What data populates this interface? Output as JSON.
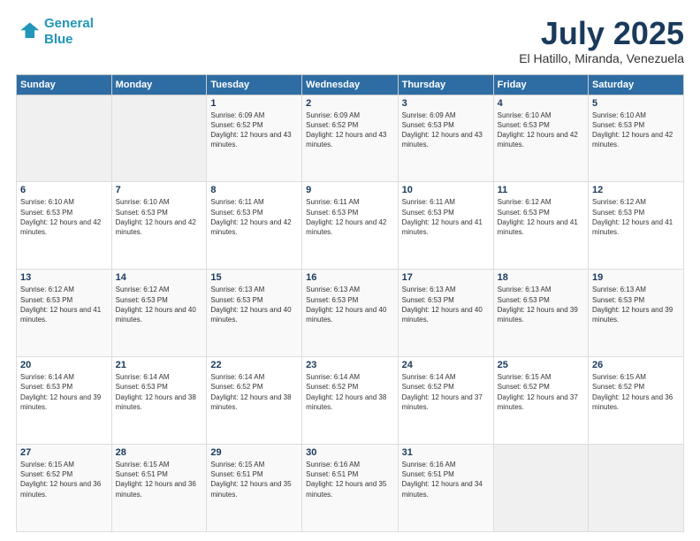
{
  "logo": {
    "line1": "General",
    "line2": "Blue"
  },
  "title": "July 2025",
  "subtitle": "El Hatillo, Miranda, Venezuela",
  "days_header": [
    "Sunday",
    "Monday",
    "Tuesday",
    "Wednesday",
    "Thursday",
    "Friday",
    "Saturday"
  ],
  "weeks": [
    [
      {
        "day": "",
        "info": ""
      },
      {
        "day": "",
        "info": ""
      },
      {
        "day": "1",
        "info": "Sunrise: 6:09 AM\nSunset: 6:52 PM\nDaylight: 12 hours and 43 minutes."
      },
      {
        "day": "2",
        "info": "Sunrise: 6:09 AM\nSunset: 6:52 PM\nDaylight: 12 hours and 43 minutes."
      },
      {
        "day": "3",
        "info": "Sunrise: 6:09 AM\nSunset: 6:53 PM\nDaylight: 12 hours and 43 minutes."
      },
      {
        "day": "4",
        "info": "Sunrise: 6:10 AM\nSunset: 6:53 PM\nDaylight: 12 hours and 42 minutes."
      },
      {
        "day": "5",
        "info": "Sunrise: 6:10 AM\nSunset: 6:53 PM\nDaylight: 12 hours and 42 minutes."
      }
    ],
    [
      {
        "day": "6",
        "info": "Sunrise: 6:10 AM\nSunset: 6:53 PM\nDaylight: 12 hours and 42 minutes."
      },
      {
        "day": "7",
        "info": "Sunrise: 6:10 AM\nSunset: 6:53 PM\nDaylight: 12 hours and 42 minutes."
      },
      {
        "day": "8",
        "info": "Sunrise: 6:11 AM\nSunset: 6:53 PM\nDaylight: 12 hours and 42 minutes."
      },
      {
        "day": "9",
        "info": "Sunrise: 6:11 AM\nSunset: 6:53 PM\nDaylight: 12 hours and 42 minutes."
      },
      {
        "day": "10",
        "info": "Sunrise: 6:11 AM\nSunset: 6:53 PM\nDaylight: 12 hours and 41 minutes."
      },
      {
        "day": "11",
        "info": "Sunrise: 6:12 AM\nSunset: 6:53 PM\nDaylight: 12 hours and 41 minutes."
      },
      {
        "day": "12",
        "info": "Sunrise: 6:12 AM\nSunset: 6:53 PM\nDaylight: 12 hours and 41 minutes."
      }
    ],
    [
      {
        "day": "13",
        "info": "Sunrise: 6:12 AM\nSunset: 6:53 PM\nDaylight: 12 hours and 41 minutes."
      },
      {
        "day": "14",
        "info": "Sunrise: 6:12 AM\nSunset: 6:53 PM\nDaylight: 12 hours and 40 minutes."
      },
      {
        "day": "15",
        "info": "Sunrise: 6:13 AM\nSunset: 6:53 PM\nDaylight: 12 hours and 40 minutes."
      },
      {
        "day": "16",
        "info": "Sunrise: 6:13 AM\nSunset: 6:53 PM\nDaylight: 12 hours and 40 minutes."
      },
      {
        "day": "17",
        "info": "Sunrise: 6:13 AM\nSunset: 6:53 PM\nDaylight: 12 hours and 40 minutes."
      },
      {
        "day": "18",
        "info": "Sunrise: 6:13 AM\nSunset: 6:53 PM\nDaylight: 12 hours and 39 minutes."
      },
      {
        "day": "19",
        "info": "Sunrise: 6:13 AM\nSunset: 6:53 PM\nDaylight: 12 hours and 39 minutes."
      }
    ],
    [
      {
        "day": "20",
        "info": "Sunrise: 6:14 AM\nSunset: 6:53 PM\nDaylight: 12 hours and 39 minutes."
      },
      {
        "day": "21",
        "info": "Sunrise: 6:14 AM\nSunset: 6:53 PM\nDaylight: 12 hours and 38 minutes."
      },
      {
        "day": "22",
        "info": "Sunrise: 6:14 AM\nSunset: 6:52 PM\nDaylight: 12 hours and 38 minutes."
      },
      {
        "day": "23",
        "info": "Sunrise: 6:14 AM\nSunset: 6:52 PM\nDaylight: 12 hours and 38 minutes."
      },
      {
        "day": "24",
        "info": "Sunrise: 6:14 AM\nSunset: 6:52 PM\nDaylight: 12 hours and 37 minutes."
      },
      {
        "day": "25",
        "info": "Sunrise: 6:15 AM\nSunset: 6:52 PM\nDaylight: 12 hours and 37 minutes."
      },
      {
        "day": "26",
        "info": "Sunrise: 6:15 AM\nSunset: 6:52 PM\nDaylight: 12 hours and 36 minutes."
      }
    ],
    [
      {
        "day": "27",
        "info": "Sunrise: 6:15 AM\nSunset: 6:52 PM\nDaylight: 12 hours and 36 minutes."
      },
      {
        "day": "28",
        "info": "Sunrise: 6:15 AM\nSunset: 6:51 PM\nDaylight: 12 hours and 36 minutes."
      },
      {
        "day": "29",
        "info": "Sunrise: 6:15 AM\nSunset: 6:51 PM\nDaylight: 12 hours and 35 minutes."
      },
      {
        "day": "30",
        "info": "Sunrise: 6:16 AM\nSunset: 6:51 PM\nDaylight: 12 hours and 35 minutes."
      },
      {
        "day": "31",
        "info": "Sunrise: 6:16 AM\nSunset: 6:51 PM\nDaylight: 12 hours and 34 minutes."
      },
      {
        "day": "",
        "info": ""
      },
      {
        "day": "",
        "info": ""
      }
    ]
  ]
}
